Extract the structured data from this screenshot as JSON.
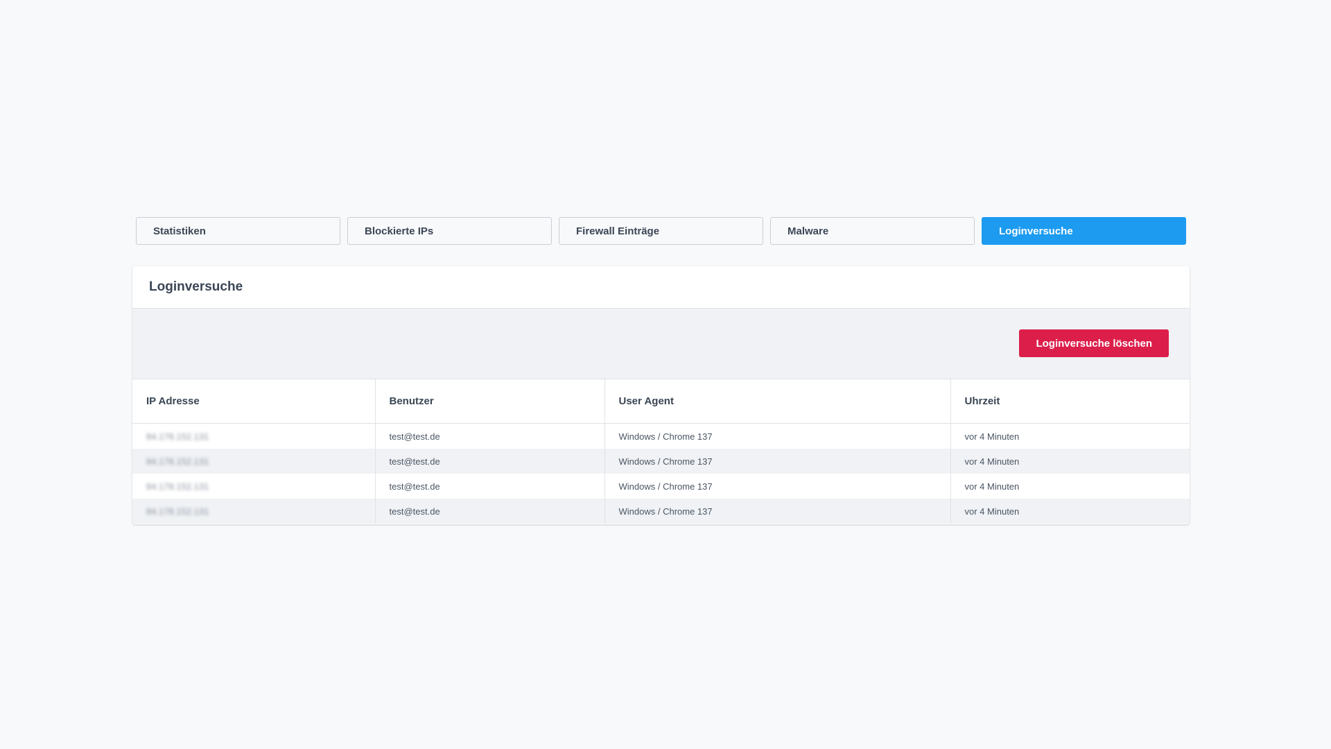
{
  "tabs": [
    {
      "label": "Statistiken",
      "active": false
    },
    {
      "label": "Blockierte IPs",
      "active": false
    },
    {
      "label": "Firewall Einträge",
      "active": false
    },
    {
      "label": "Malware",
      "active": false
    },
    {
      "label": "Loginversuche",
      "active": true
    }
  ],
  "card": {
    "title": "Loginversuche",
    "delete_button_label": "Loginversuche löschen"
  },
  "table": {
    "columns": [
      "IP Adresse",
      "Benutzer",
      "User Agent",
      "Uhrzeit"
    ],
    "rows": [
      {
        "ip": "84.178.152.131",
        "user": "test@test.de",
        "agent": "Windows / Chrome 137",
        "time": "vor 4 Minuten"
      },
      {
        "ip": "84.178.152.131",
        "user": "test@test.de",
        "agent": "Windows / Chrome 137",
        "time": "vor 4 Minuten"
      },
      {
        "ip": "84.178.152.131",
        "user": "test@test.de",
        "agent": "Windows / Chrome 137",
        "time": "vor 4 Minuten"
      },
      {
        "ip": "84.178.152.131",
        "user": "test@test.de",
        "agent": "Windows / Chrome 137",
        "time": "vor 4 Minuten"
      }
    ]
  },
  "colors": {
    "accent": "#1c9bf0",
    "danger": "#dc1e4a",
    "background": "#f8f9fb"
  }
}
